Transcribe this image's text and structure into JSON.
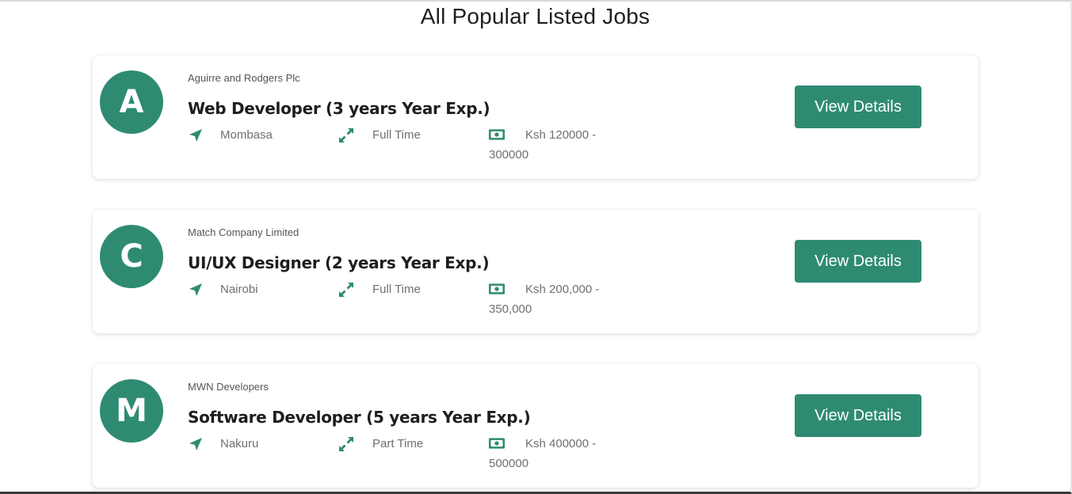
{
  "page": {
    "title": "All Popular Listed Jobs"
  },
  "jobs": [
    {
      "initial": "A",
      "company": "Aguirre and Rodgers Plc",
      "title": "Web Developer (3 years Year Exp.)",
      "location": "Mombasa",
      "type": "Full Time",
      "salary": "Ksh 120000 - 300000",
      "button_label": "View Details"
    },
    {
      "initial": "C",
      "company": "Match Company Limited",
      "title": "UI/UX Designer (2 years Year Exp.)",
      "location": "Nairobi",
      "type": "Full Time",
      "salary": "Ksh 200,000 - 350,000",
      "button_label": "View Details"
    },
    {
      "initial": "M",
      "company": "MWN Developers",
      "title": "Software Developer (5 years Year Exp.)",
      "location": "Nakuru",
      "type": "Part Time",
      "salary": "Ksh 400000 - 500000",
      "button_label": "View Details"
    }
  ],
  "icons": {
    "location": "location-arrow-icon",
    "job_type": "expand-arrows-icon",
    "salary": "money-bill-icon"
  },
  "colors": {
    "accent": "#2e8b72",
    "title_text": "#1e1e1e",
    "meta_text": "#6f6f6f"
  }
}
